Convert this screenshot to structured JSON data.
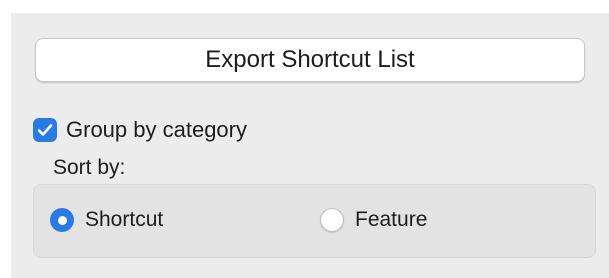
{
  "export": {
    "label": "Export Shortcut List"
  },
  "group": {
    "label": "Group by category",
    "checked": true
  },
  "sort": {
    "label": "Sort by:",
    "options": [
      {
        "label": "Shortcut",
        "selected": true
      },
      {
        "label": "Feature",
        "selected": false
      }
    ]
  },
  "colors": {
    "accent": "#2a7ae4",
    "panel": "#ececec"
  },
  "icons": {
    "checkbox": "checkmark-icon",
    "radio_selected": "radio-selected-icon",
    "radio_unselected": "radio-unselected-icon"
  }
}
